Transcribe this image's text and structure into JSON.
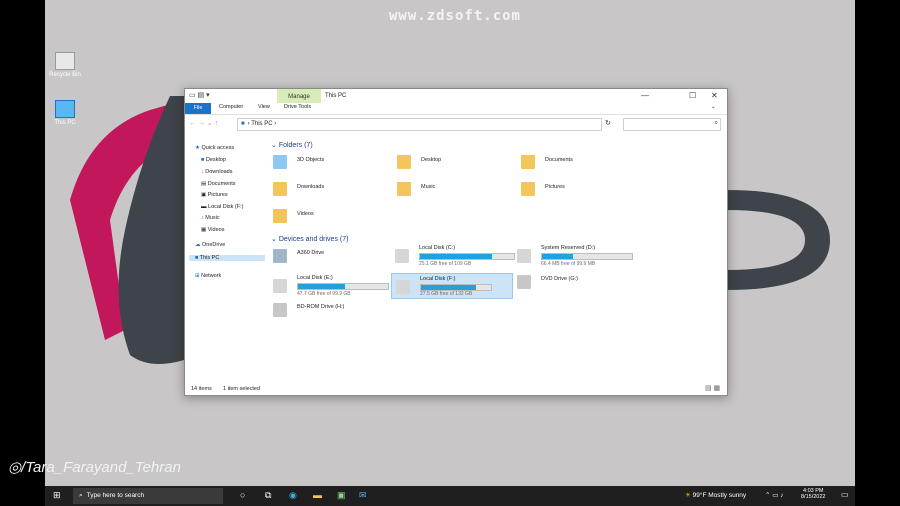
{
  "watermark": "www.zdsoft.com",
  "social_handle": "/Tara_Farayand_Tehran",
  "brand_text": "hran",
  "desktop_icons": [
    {
      "label": "Recycle Bin",
      "icon": "recycle-bin-icon"
    },
    {
      "label": "This PC",
      "icon": "this-pc-icon"
    }
  ],
  "window": {
    "manage_tab": "Manage",
    "title": "This PC",
    "ribbon_tabs": [
      "File",
      "Computer",
      "View",
      "Drive Tools"
    ],
    "address": "This PC",
    "nav": [
      {
        "label": "Quick access"
      },
      {
        "label": "Desktop"
      },
      {
        "label": "Downloads"
      },
      {
        "label": "Documents"
      },
      {
        "label": "Pictures"
      },
      {
        "label": "Local Disk (F:)"
      },
      {
        "label": "Music"
      },
      {
        "label": "Videos"
      },
      {
        "label": "OneDrive"
      },
      {
        "label": "This PC"
      },
      {
        "label": "Network"
      }
    ],
    "folders_header": "Folders (7)",
    "folders": [
      "3D Objects",
      "Desktop",
      "Documents",
      "Downloads",
      "Music",
      "Pictures",
      "Videos"
    ],
    "drives_header": "Devices and drives (7)",
    "drives": [
      {
        "name": "A360 Drive",
        "free": "",
        "used_fraction": null
      },
      {
        "name": "Local Disk (C:)",
        "free": "25.1 GB free of 109 GB",
        "used_fraction": 0.77
      },
      {
        "name": "System Reserved (D:)",
        "free": "66.4 MB free of 99.9 MB",
        "used_fraction": 0.34
      },
      {
        "name": "Local Disk (E:)",
        "free": "47.7 GB free of 99.9 GB",
        "used_fraction": 0.52
      },
      {
        "name": "Local Disk (F:)",
        "free": "27.5 GB free of 132 GB",
        "used_fraction": 0.79
      },
      {
        "name": "DVD Drive (G:)",
        "free": "",
        "used_fraction": null
      },
      {
        "name": "BD-ROM Drive (H:)",
        "free": "",
        "used_fraction": null
      }
    ],
    "status_items": "14 items",
    "status_selected": "1 item selected"
  },
  "taskbar": {
    "search_placeholder": "Type here to search",
    "weather": "99°F  Mostly sunny",
    "time": "4:03 PM",
    "date": "8/15/2022"
  },
  "colors": {
    "accent": "#1a73c8",
    "bar_fill": "#26a0da",
    "brand_pink": "#c2185b",
    "brand_gray": "#3e4449"
  }
}
